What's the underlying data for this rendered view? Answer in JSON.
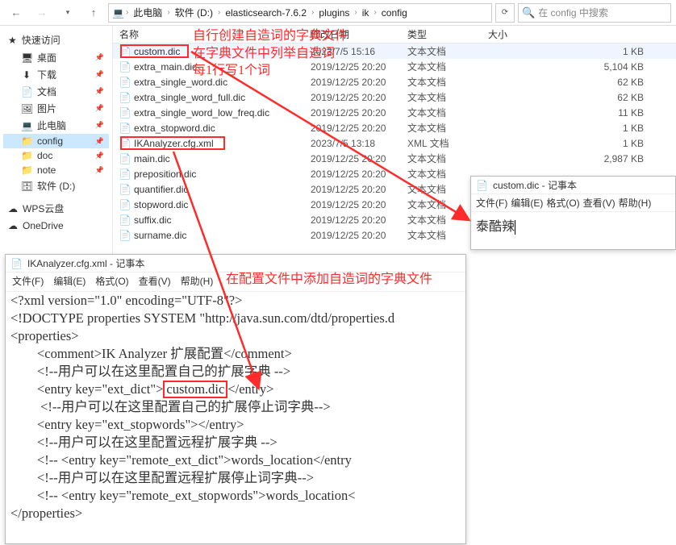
{
  "explorer": {
    "breadcrumbs": [
      "此电脑",
      "软件 (D:)",
      "elasticsearch-7.6.2",
      "plugins",
      "ik",
      "config"
    ],
    "searchPlaceholder": "在 config 中搜索",
    "columns": {
      "name": "名称",
      "modified": "修改日期",
      "type": "类型",
      "size": "大小"
    },
    "nav": {
      "quick": "快速访问",
      "items": [
        {
          "label": "桌面",
          "pin": true,
          "icon": "desktop-icon"
        },
        {
          "label": "下载",
          "pin": true,
          "icon": "download-icon"
        },
        {
          "label": "文档",
          "pin": true,
          "icon": "document-icon"
        },
        {
          "label": "图片",
          "pin": true,
          "icon": "picture-icon"
        },
        {
          "label": "此电脑",
          "pin": true,
          "icon": "pc-icon"
        },
        {
          "label": "config",
          "pin": true,
          "icon": "folder-icon"
        },
        {
          "label": "doc",
          "pin": true,
          "icon": "folder-icon"
        },
        {
          "label": "note",
          "pin": true,
          "icon": "folder-icon"
        },
        {
          "label": "软件 (D:)",
          "pin": false,
          "icon": "drive-icon"
        }
      ],
      "wps": "WPS云盘",
      "onedrive": "OneDrive"
    },
    "files": [
      {
        "name": "custom.dic",
        "mod": "2023/7/5 15:16",
        "type": "文本文档",
        "size": "1 KB"
      },
      {
        "name": "extra_main.dic",
        "mod": "2019/12/25 20:20",
        "type": "文本文档",
        "size": "5,104 KB"
      },
      {
        "name": "extra_single_word.dic",
        "mod": "2019/12/25 20:20",
        "type": "文本文档",
        "size": "62 KB"
      },
      {
        "name": "extra_single_word_full.dic",
        "mod": "2019/12/25 20:20",
        "type": "文本文档",
        "size": "62 KB"
      },
      {
        "name": "extra_single_word_low_freq.dic",
        "mod": "2019/12/25 20:20",
        "type": "文本文档",
        "size": "11 KB"
      },
      {
        "name": "extra_stopword.dic",
        "mod": "2019/12/25 20:20",
        "type": "文本文档",
        "size": "1 KB"
      },
      {
        "name": "IKAnalyzer.cfg.xml",
        "mod": "2023/7/5 13:18",
        "type": "XML 文档",
        "size": "1 KB"
      },
      {
        "name": "main.dic",
        "mod": "2019/12/25 20:20",
        "type": "文本文档",
        "size": "2,987 KB"
      },
      {
        "name": "preposition.dic",
        "mod": "2019/12/25 20:20",
        "type": "文本文档",
        "size": ""
      },
      {
        "name": "quantifier.dic",
        "mod": "2019/12/25 20:20",
        "type": "文本文档",
        "size": ""
      },
      {
        "name": "stopword.dic",
        "mod": "2019/12/25 20:20",
        "type": "文本文档",
        "size": ""
      },
      {
        "name": "suffix.dic",
        "mod": "2019/12/25 20:20",
        "type": "文本文档",
        "size": ""
      },
      {
        "name": "surname.dic",
        "mod": "2019/12/25 20:20",
        "type": "文本文档",
        "size": ""
      }
    ]
  },
  "annotation": {
    "a1": "自行创建自造词的字典文件",
    "a2": "在字典文件中列举自造词",
    "a3": "每1行写1个词",
    "a4": "在配置文件中添加自造词的字典文件"
  },
  "notepad1": {
    "title": "IKAnalyzer.cfg.xml - 记事本",
    "menu": {
      "file": "文件(F)",
      "edit": "编辑(E)",
      "format": "格式(O)",
      "view": "查看(V)",
      "help": "帮助(H)"
    },
    "lines": [
      "<?xml version=\"1.0\" encoding=\"UTF-8\"?>",
      "<!DOCTYPE properties SYSTEM \"http://java.sun.com/dtd/properties.d",
      "<properties>",
      "        <comment>IK Analyzer 扩展配置</comment>",
      "        <!--用户可以在这里配置自己的扩展字典 -->",
      "        <entry key=\"ext_dict\">",
      "custom.dic",
      "</entry>",
      "         <!--用户可以在这里配置自己的扩展停止词字典-->",
      "        <entry key=\"ext_stopwords\"></entry>",
      "        <!--用户可以在这里配置远程扩展字典 -->",
      "        <!-- <entry key=\"remote_ext_dict\">words_location</entry",
      "        <!--用户可以在这里配置远程扩展停止词字典-->",
      "        <!-- <entry key=\"remote_ext_stopwords\">words_location<",
      "</properties>"
    ]
  },
  "notepad2": {
    "title": "custom.dic - 记事本",
    "menu": {
      "file": "文件(F)",
      "edit": "编辑(E)",
      "format": "格式(O)",
      "view": "查看(V)",
      "help": "帮助(H)"
    },
    "content": "泰酷辣"
  }
}
